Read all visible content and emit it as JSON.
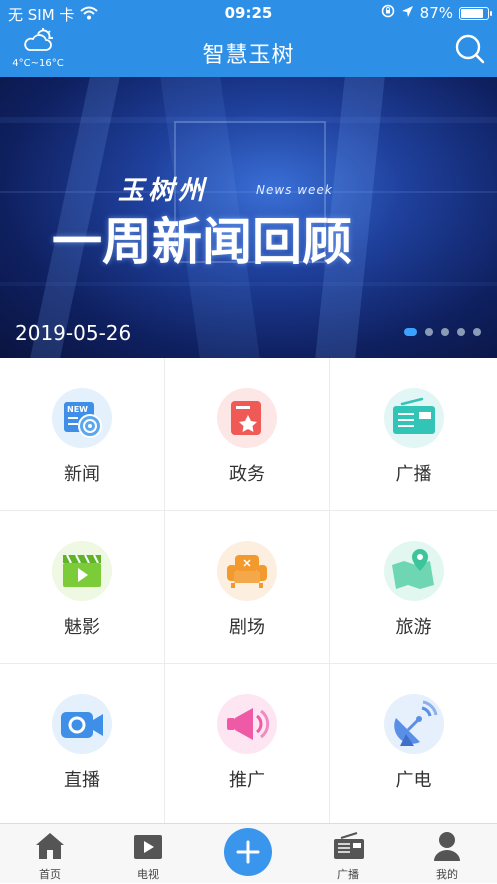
{
  "status_bar": {
    "carrier": "无 SIM 卡",
    "time": "09:25",
    "battery": "87%"
  },
  "header": {
    "title": "智慧玉树",
    "weather_temp": "4°C~16°C"
  },
  "banner": {
    "date": "2019-05-26",
    "slide_count": 5,
    "active_slide": 1,
    "title_small": "玉树州",
    "title_en": "News week",
    "title_big": "一周新闻回顾"
  },
  "grid": [
    {
      "label": "新闻",
      "icon": "news-icon",
      "color": "#3f8fe8"
    },
    {
      "label": "政务",
      "icon": "government-icon",
      "color": "#ef5a56"
    },
    {
      "label": "广播",
      "icon": "radio-icon",
      "color": "#33c4b8"
    },
    {
      "label": "魅影",
      "icon": "video-icon",
      "color": "#7ccc3a"
    },
    {
      "label": "剧场",
      "icon": "theater-icon",
      "color": "#f29a2e"
    },
    {
      "label": "旅游",
      "icon": "travel-map-icon",
      "color": "#3cc49a"
    },
    {
      "label": "直播",
      "icon": "live-camera-icon",
      "color": "#3f8fe8"
    },
    {
      "label": "推广",
      "icon": "promotion-megaphone-icon",
      "color": "#ef5aa6"
    },
    {
      "label": "广电",
      "icon": "broadcast-dish-icon",
      "color": "#5a8fe8"
    }
  ],
  "tabbar": [
    {
      "label": "首页",
      "icon": "home-icon"
    },
    {
      "label": "电视",
      "icon": "tv-play-icon"
    },
    {
      "label": "",
      "icon": "plus-icon"
    },
    {
      "label": "广播",
      "icon": "radio-icon"
    },
    {
      "label": "我的",
      "icon": "user-icon"
    }
  ]
}
